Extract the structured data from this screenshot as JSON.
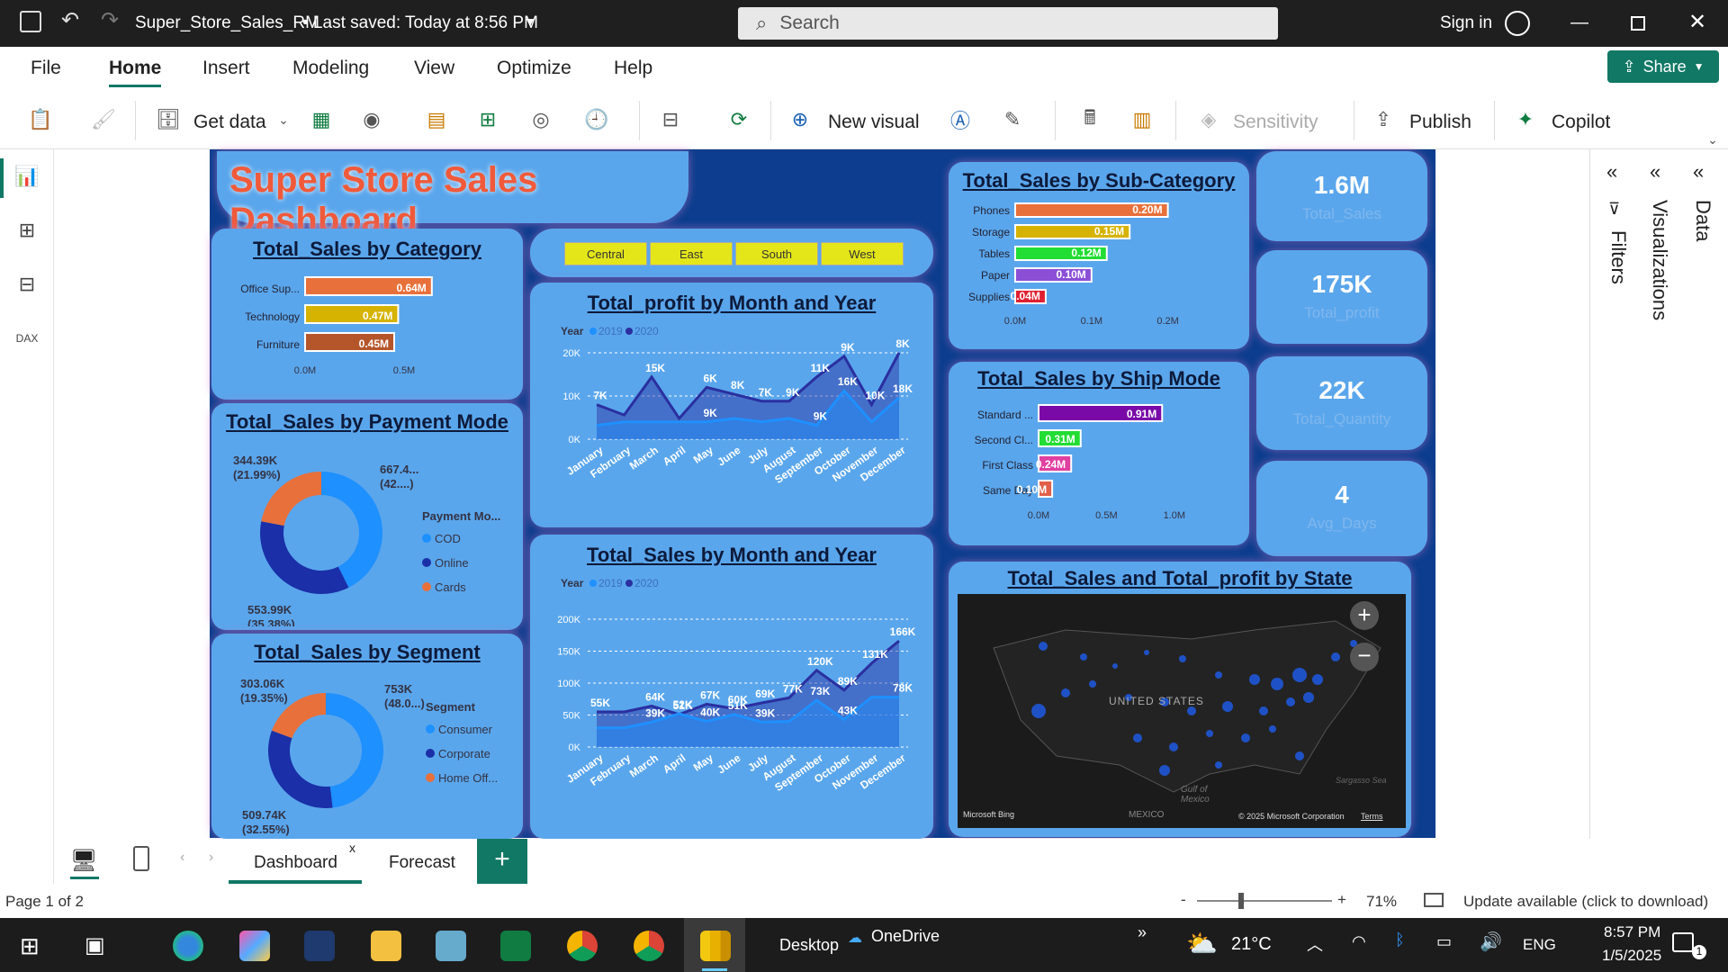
{
  "titlebar": {
    "doc_title": "Super_Store_Sales_RM",
    "saved": "• Last saved: Today at 8:56 PM",
    "search_placeholder": "Search",
    "signin": "Sign in"
  },
  "menu": [
    "File",
    "Home",
    "Insert",
    "Modeling",
    "View",
    "Optimize",
    "Help"
  ],
  "share_label": "Share",
  "ribbon": {
    "get_data": "Get data",
    "new_visual": "New visual",
    "sensitivity": "Sensitivity",
    "publish": "Publish",
    "copilot": "Copilot"
  },
  "dashboard": {
    "title": "Super Store Sales Dashboard",
    "regions": [
      "Central",
      "East",
      "South",
      "West"
    ],
    "kpis": [
      {
        "value": "1.6M",
        "label": "Total_Sales"
      },
      {
        "value": "175K",
        "label": "Total_profit"
      },
      {
        "value": "22K",
        "label": "Total_Quantity"
      },
      {
        "value": "4",
        "label": "Avg_Days"
      }
    ],
    "map": {
      "title": "Total_Sales and Total_profit by State",
      "country_label": "UNITED STATES",
      "gulf": "Gulf of Mexico",
      "mexico": "MEXICO",
      "sargasso": "Sargasso Sea",
      "bing": "Microsoft Bing",
      "copyright": "© 2025 Microsoft Corporation",
      "terms": "Terms"
    }
  },
  "chart_data": [
    {
      "type": "bar",
      "title": "Total_Sales by Category",
      "categories": [
        "Office Sup...",
        "Technology",
        "Furniture"
      ],
      "values": [
        0.64,
        0.47,
        0.45
      ],
      "labels": [
        "0.64M",
        "0.47M",
        "0.45M"
      ],
      "colors": [
        "#e8703a",
        "#d6b300",
        "#b5562a"
      ],
      "ticks": [
        "0.0M",
        "0.5M"
      ]
    },
    {
      "type": "pie",
      "title": "Total_Sales by Payment Mode",
      "legend_title": "Payment Mo...",
      "slices": [
        {
          "name": "COD",
          "value": 667.4,
          "label": "667.4...",
          "pct": "(42....)",
          "color": "#1e90ff"
        },
        {
          "name": "Online",
          "value": 553.99,
          "label": "553.99K",
          "pct": "(35.38%)",
          "color": "#1a2fa8"
        },
        {
          "name": "Cards",
          "value": 344.39,
          "label": "344.39K",
          "pct": "(21.99%)",
          "color": "#e8703a"
        }
      ]
    },
    {
      "type": "pie",
      "title": "Total_Sales by Segment",
      "legend_title": "Segment",
      "slices": [
        {
          "name": "Consumer",
          "value": 753,
          "label": "753K",
          "pct": "(48.0...)",
          "color": "#1e90ff"
        },
        {
          "name": "Corporate",
          "value": 509.74,
          "label": "509.74K",
          "pct": "(32.55%)",
          "color": "#1a2fa8"
        },
        {
          "name": "Home Off...",
          "value": 303.06,
          "label": "303.06K",
          "pct": "(19.35%)",
          "color": "#e8703a"
        }
      ]
    },
    {
      "type": "area",
      "title": "Total_profit by Month and Year",
      "legend_title": "Year",
      "x": [
        "January",
        "February",
        "March",
        "April",
        "May",
        "June",
        "July",
        "August",
        "September",
        "October",
        "November",
        "December"
      ],
      "ylim": [
        0,
        25
      ],
      "yticks": [
        "0K",
        "10K",
        "20K"
      ],
      "series": [
        {
          "name": "2020",
          "color": "#2a2fa0",
          "values": [
            10,
            7,
            18,
            6,
            15,
            13,
            11,
            11,
            18,
            24,
            10,
            25
          ],
          "labels": [
            "7K",
            "",
            "15K",
            "",
            "6K",
            "8K",
            "7K",
            "9K",
            "11K",
            "9K",
            "10K",
            "8K"
          ]
        },
        {
          "name": "2019",
          "color": "#1e90ff",
          "values": [
            4,
            5,
            5,
            5,
            5,
            6,
            5,
            6,
            4,
            14,
            5,
            12
          ],
          "labels": [
            "",
            "",
            "",
            "",
            "9K",
            "",
            "",
            "",
            "9K",
            "16K",
            "",
            "18K"
          ]
        }
      ]
    },
    {
      "type": "area",
      "title": "Total_Sales by Month and Year",
      "legend_title": "Year",
      "x": [
        "January",
        "February",
        "March",
        "April",
        "May",
        "June",
        "July",
        "August",
        "September",
        "October",
        "November",
        "December"
      ],
      "ylim": [
        0,
        200
      ],
      "yticks": [
        "0K",
        "50K",
        "100K",
        "150K",
        "200K"
      ],
      "series": [
        {
          "name": "2020",
          "color": "#2a2fa0",
          "values": [
            55,
            55,
            64,
            51,
            67,
            60,
            69,
            77,
            120,
            89,
            131,
            166
          ],
          "labels": [
            "55K",
            "",
            "64K",
            "51K",
            "67K",
            "60K",
            "69K",
            "77K",
            "120K",
            "89K",
            "131K",
            "166K"
          ]
        },
        {
          "name": "2019",
          "color": "#1e90ff",
          "values": [
            30,
            30,
            39,
            52,
            40,
            51,
            39,
            40,
            73,
            43,
            78,
            78
          ],
          "labels": [
            "",
            "",
            "39K",
            "52K",
            "40K",
            "51K",
            "39K",
            "",
            "73K",
            "43K",
            "",
            "78K"
          ]
        }
      ]
    },
    {
      "type": "bar",
      "title": "Total_Sales by Sub-Category",
      "categories": [
        "Phones",
        "Storage",
        "Tables",
        "Paper",
        "Supplies"
      ],
      "values": [
        0.2,
        0.15,
        0.12,
        0.1,
        0.04
      ],
      "labels": [
        "0.20M",
        "0.15M",
        "0.12M",
        "0.10M",
        "0.04M"
      ],
      "colors": [
        "#e8703a",
        "#d6b300",
        "#22dd33",
        "#8b4fd6",
        "#e02030"
      ],
      "ticks": [
        "0.0M",
        "0.1M",
        "0.2M"
      ]
    },
    {
      "type": "bar",
      "title": "Total_Sales by Ship Mode",
      "categories": [
        "Standard ...",
        "Second Cl...",
        "First Class",
        "Same Day"
      ],
      "values": [
        0.91,
        0.31,
        0.24,
        0.1
      ],
      "labels": [
        "0.91M",
        "0.31M",
        "0.24M",
        "0.10M"
      ],
      "colors": [
        "#7a0aa8",
        "#22dd33",
        "#e040a0",
        "#e0604a"
      ],
      "ticks": [
        "0.0M",
        "0.5M",
        "1.0M"
      ]
    }
  ],
  "pages": [
    "Dashboard",
    "Forecast"
  ],
  "status": {
    "page": "Page 1 of 2",
    "zoom": "71%",
    "update": "Update available (click to download)"
  },
  "panes": [
    "Filters",
    "Visualizations",
    "Data"
  ],
  "taskbar": {
    "desktop": "Desktop",
    "onedrive": "OneDrive",
    "weather": "21°C",
    "lang": "ENG",
    "time": "8:57 PM",
    "date": "1/5/2025",
    "notif": "1"
  }
}
